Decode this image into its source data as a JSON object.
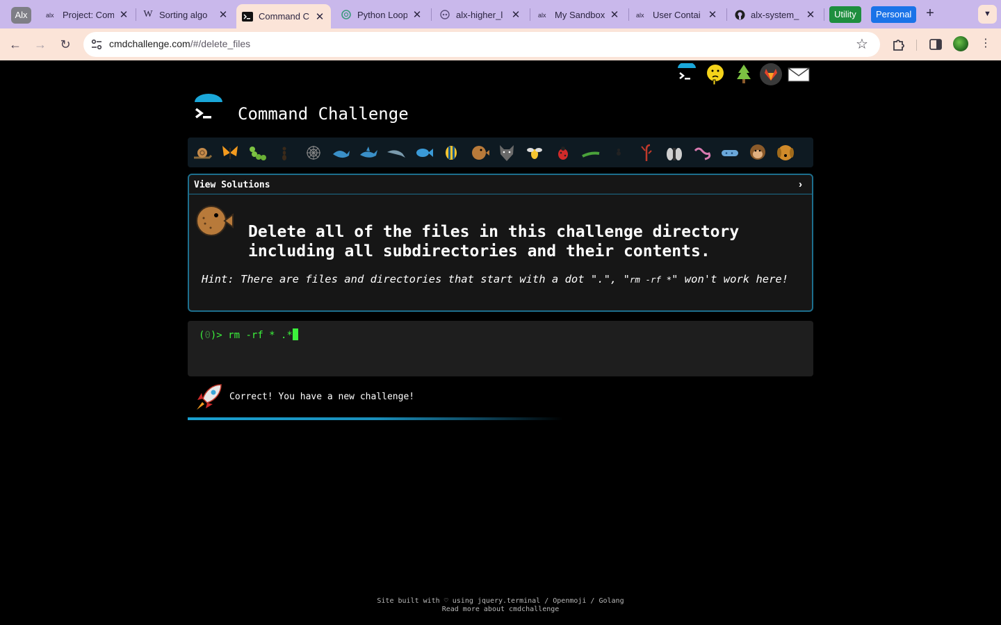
{
  "browser": {
    "profile_badge": "Alx",
    "tabs": [
      {
        "title": "Project: Com",
        "favicon": "alx-favicon"
      },
      {
        "title": "Sorting algo",
        "favicon": "wikipedia-favicon"
      },
      {
        "title": "Command C",
        "favicon": "terminal-favicon"
      },
      {
        "title": "Python Loop",
        "favicon": "chatgpt-favicon"
      },
      {
        "title": "alx-higher_l",
        "favicon": "github-copilot-favicon"
      },
      {
        "title": "My Sandbox",
        "favicon": "alx-favicon"
      },
      {
        "title": "User Contai",
        "favicon": "alx-favicon"
      },
      {
        "title": "alx-system_",
        "favicon": "github-favicon"
      }
    ],
    "group_utility": "Utility",
    "group_personal": "Personal",
    "group_utility_color": "#1e8e3e",
    "group_personal_color": "#1a73e8",
    "url_host": "cmdchallenge.com",
    "url_path": "/#/delete_files"
  },
  "page": {
    "site_title": "Command Challenge",
    "view_solutions": "View Solutions",
    "challenge_line1": "Delete all of the files in this challenge directory",
    "challenge_line2": "including all subdirectories and their contents.",
    "hint_prefix": "Hint: There are files and directories that start with a dot \".\", \"",
    "hint_code": "rm -rf *",
    "hint_suffix": "\" won't work here!",
    "prompt_open": "(",
    "prompt_num": "0",
    "prompt_close": ")> ",
    "command": "rm -rf * .*",
    "result": "Correct! You have a new challenge!",
    "footer_line1": "Site built with ♡ using jquery.terminal / Openmoji / Golang",
    "footer_line2": "Read more about cmdchallenge",
    "accent_color": "#1d6f8e",
    "terminal_text_color": "#3cf23c"
  }
}
